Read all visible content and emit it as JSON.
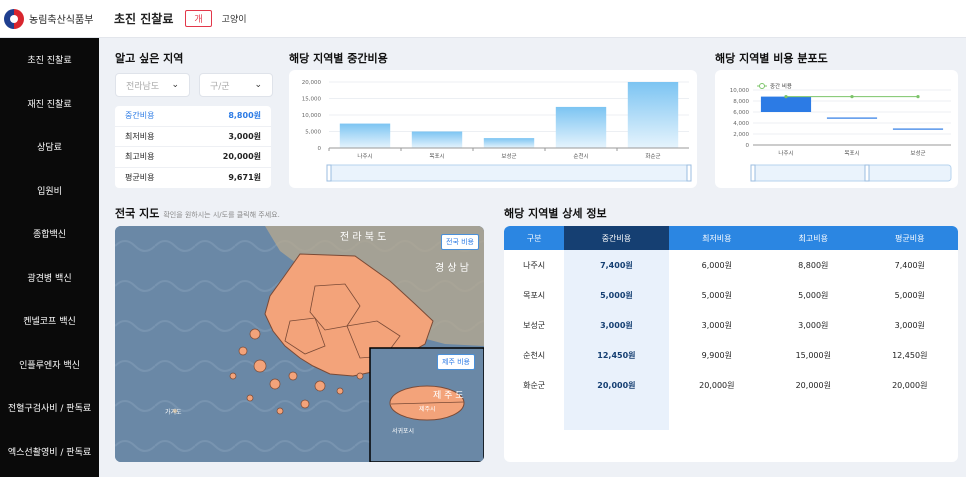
{
  "header": {
    "org_name": "농림축산식품부",
    "page_title": "초진 진찰료",
    "tag_dog": "개",
    "tag_cat": "고양이"
  },
  "sidebar": {
    "items": [
      {
        "label": "초진 진찰료"
      },
      {
        "label": "재진 진찰료"
      },
      {
        "label": "상담료"
      },
      {
        "label": "입원비"
      },
      {
        "label": "종합백신"
      },
      {
        "label": "광견병 백신"
      },
      {
        "label": "켄넬코프 백신"
      },
      {
        "label": "인플루엔자 백신"
      },
      {
        "label": "전혈구검사비 / 판독료"
      },
      {
        "label": "엑스선촬영비 / 판독료"
      }
    ]
  },
  "region": {
    "title": "알고 싶은 지역",
    "province_select": "전라남도",
    "district_select": "구/군",
    "stats": [
      {
        "label": "중간비용",
        "value": "8,800원"
      },
      {
        "label": "최저비용",
        "value": "3,000원"
      },
      {
        "label": "최고비용",
        "value": "20,000원"
      },
      {
        "label": "평균비용",
        "value": "9,671원"
      }
    ]
  },
  "bar_title": "해당 지역별 중간비용",
  "scatter_title": "해당 지역별 비용 분포도",
  "chart_data": [
    {
      "type": "bar",
      "title": "해당 지역별 중간비용",
      "categories": [
        "나주시",
        "목포시",
        "보성군",
        "순천시",
        "화순군"
      ],
      "values": [
        7400,
        5000,
        3000,
        12450,
        20000
      ],
      "yticks": [
        "20,000",
        "15,000",
        "10,000",
        "5,000",
        "0"
      ],
      "ylim": [
        0,
        20000
      ],
      "grid": true,
      "color": "#7cc4f2"
    },
    {
      "type": "line",
      "title": "해당 지역별 비용 분포도",
      "categories": [
        "나주시",
        "목포시",
        "보성군"
      ],
      "series": [
        {
          "name": "중간 비용",
          "values": [
            8800,
            8800,
            8800
          ]
        }
      ],
      "ranges": [
        [
          6000,
          8800
        ],
        [
          5000,
          5000
        ],
        [
          3000,
          3000
        ]
      ],
      "yticks": [
        "10,000",
        "8,000",
        "6,000",
        "4,000",
        "2,000",
        "0"
      ],
      "ylim": [
        0,
        10000
      ],
      "legend": "top-left",
      "line_color": "#7cc46a",
      "range_color": "#2c7be5"
    }
  ],
  "map": {
    "title": "전국 지도",
    "subtitle": "확인을 원하시는 시/도를 클릭해 주세요.",
    "national_button": "전국 비용",
    "jeju_button": "제주 비용",
    "label_jeolla": "전 라 북 도",
    "label_gyeongsang": "경 상 남",
    "label_jeju": "제 주 도",
    "label_seogwipo": "서귀포시",
    "label_jeju_si": "제주시",
    "label_gageodo": "가거도"
  },
  "detail": {
    "title": "해당 지역별 상세 정보",
    "columns": [
      "구분",
      "중간비용",
      "최저비용",
      "최고비용",
      "평균비용"
    ],
    "rows": [
      [
        "나주시",
        "7,400원",
        "6,000원",
        "8,800원",
        "7,400원"
      ],
      [
        "목포시",
        "5,000원",
        "5,000원",
        "5,000원",
        "5,000원"
      ],
      [
        "보성군",
        "3,000원",
        "3,000원",
        "3,000원",
        "3,000원"
      ],
      [
        "순천시",
        "12,450원",
        "9,900원",
        "15,000원",
        "12,450원"
      ],
      [
        "화순군",
        "20,000원",
        "20,000원",
        "20,000원",
        "20,000원"
      ]
    ]
  }
}
